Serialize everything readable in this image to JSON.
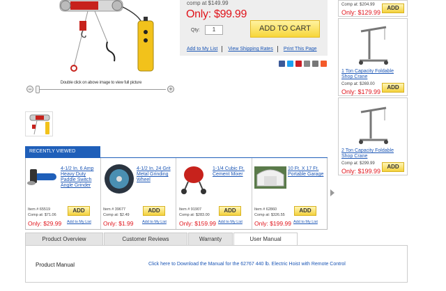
{
  "product": {
    "image_zoom_caption": "Double click on above image to view full picture",
    "comp_price": "comp at $149.99",
    "price": "Only: $99.99",
    "qty_label": "Qty:",
    "qty_value": "1",
    "add_to_cart": "ADD TO CART",
    "links": [
      "Add to My List",
      "View Shipping Rates",
      "Print This Page"
    ]
  },
  "share_icons": [
    {
      "name": "facebook-icon",
      "color": "#3b5998"
    },
    {
      "name": "twitter-icon",
      "color": "#1da1f2"
    },
    {
      "name": "pinterest-icon",
      "color": "#cb2027"
    },
    {
      "name": "email-icon",
      "color": "#888888"
    },
    {
      "name": "print-icon",
      "color": "#777777"
    },
    {
      "name": "more-share-icon",
      "color": "#f45a2a"
    }
  ],
  "side_items": [
    {
      "comp": "Comp at: $204.99",
      "price": "Only: $129.99",
      "add": "ADD"
    },
    {
      "name": "1 Ton Capacity Foldable Shop Crane",
      "comp": "Comp at: $269.00",
      "price": "Only: $179.99",
      "add": "ADD"
    },
    {
      "name": "2 Ton Capacity Foldable Shop Crane",
      "comp": "Comp at: $299.99",
      "price": "Only: $199.99",
      "add": "ADD"
    }
  ],
  "recently_viewed": {
    "title": "RECENTLY VIEWED",
    "items": [
      {
        "name": "4-1/2 In. 6 Amp Heavy Duty Paddle Switch Angle Grinder",
        "item": "Item # 65519",
        "comp": "Comp at: $71.06",
        "price": "Only: $29.99",
        "add": "ADD",
        "list": "Add to My List"
      },
      {
        "name": "4-1/2 In. 24 Grit Metal Grinding Wheel",
        "item": "Item # 39677",
        "comp": "Comp at: $2.49",
        "price": "Only: $1.99",
        "add": "ADD",
        "list": "Add to My List"
      },
      {
        "name": "1-1/4 Cubic Ft. Cement Mixer",
        "item": "Item # 91907",
        "comp": "Comp at: $283.00",
        "price": "Only: $159.99",
        "add": "ADD",
        "list": "Add to My List"
      },
      {
        "name": "10 Ft. X 17 Ft. Portable Garage",
        "item": "Item # 62860",
        "comp": "Comp at: $326.55",
        "price": "Only: $199.99",
        "add": "ADD",
        "list": "Add to My List"
      }
    ]
  },
  "tabs": [
    "Product Overview",
    "Customer Reviews",
    "Warranty",
    "User Manual"
  ],
  "active_tab": "User Manual",
  "manual": {
    "label": "Product Manual",
    "link": "Click here to Download the Manual for the 62767 440 lb. Electric Hoist with Remote Control"
  },
  "colors": {
    "price_red": "#e0141b",
    "link_blue": "#1a55b5",
    "tab_blue": "#1f5fb9",
    "button_yellow": "#f7d63a"
  }
}
